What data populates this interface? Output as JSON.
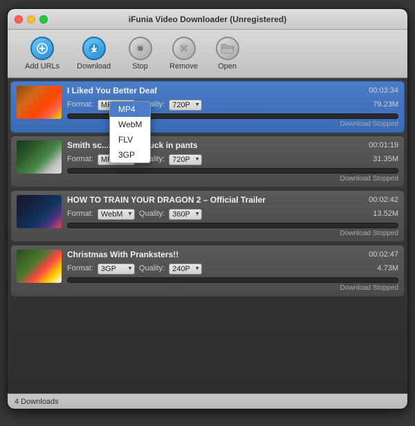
{
  "window": {
    "title": "iFunia Video Downloader (Unregistered)"
  },
  "toolbar": {
    "buttons": [
      {
        "id": "add-urls",
        "label": "Add URLs",
        "icon": "➕",
        "style": "btn-add"
      },
      {
        "id": "download",
        "label": "Download",
        "icon": "⬇",
        "style": "btn-download"
      },
      {
        "id": "stop",
        "label": "Stop",
        "icon": "⏹",
        "style": "btn-stop"
      },
      {
        "id": "remove",
        "label": "Remove",
        "icon": "✕",
        "style": "btn-remove"
      },
      {
        "id": "open",
        "label": "Open",
        "icon": "📁",
        "style": "btn-open"
      }
    ]
  },
  "downloads": [
    {
      "id": 1,
      "selected": true,
      "title": "I Liked You Better Deaf",
      "duration": "00:03:34",
      "format": "MP4",
      "quality": "720P",
      "size": "79.23M",
      "progress": 0,
      "status": "Download Stopped",
      "thumb_class": "thumb-1",
      "show_dropdown": true
    },
    {
      "id": 2,
      "selected": false,
      "title": "Smith sc...self with puck in pants",
      "duration": "00:01:19",
      "format": "MP4",
      "quality": "720P",
      "size": "31.35M",
      "progress": 0,
      "status": "Download Stopped",
      "thumb_class": "thumb-2",
      "show_dropdown": false
    },
    {
      "id": 3,
      "selected": false,
      "title": "HOW TO TRAIN YOUR DRAGON 2 – Official Trailer",
      "duration": "00:02:42",
      "format": "WebM",
      "quality": "360P",
      "size": "13.52M",
      "progress": 0,
      "status": "Download Stopped",
      "thumb_class": "thumb-3",
      "show_dropdown": false
    },
    {
      "id": 4,
      "selected": false,
      "title": "Christmas With Pranksters!!",
      "duration": "00:02:47",
      "format": "3GP",
      "quality": "240P",
      "size": "4.73M",
      "progress": 0,
      "status": "Download Stopped",
      "thumb_class": "thumb-4",
      "show_dropdown": false
    }
  ],
  "dropdown_options": [
    "MP4",
    "WebM",
    "FLV",
    "3GP"
  ],
  "statusbar": {
    "text": "4 Downloads"
  }
}
